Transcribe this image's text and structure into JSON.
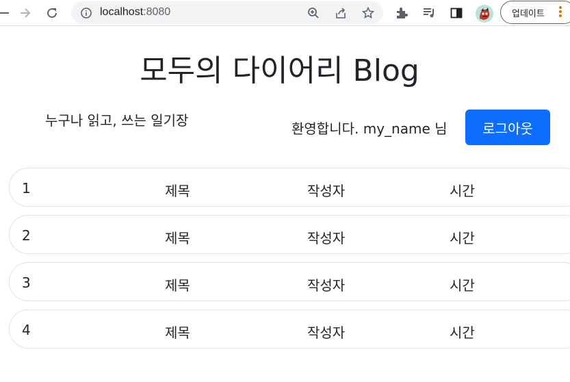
{
  "browser": {
    "url_host": "localhost",
    "url_port": ":8080",
    "update_label": "업데이트",
    "icons": [
      "back-icon",
      "forward-icon",
      "reload-icon",
      "info-icon",
      "zoom-icon",
      "share-icon",
      "star-icon",
      "extensions-icon",
      "media-icon",
      "sidebar-icon",
      "avatar",
      "menu-icon"
    ],
    "accent_color": "#e37400"
  },
  "page": {
    "title": "모두의 다이어리 Blog",
    "subtitle": "누구나 읽고, 쓰는 일기장",
    "welcome": "환영합니다. my_name 님",
    "logout_label": "로그아웃",
    "button_color": "#0d6efd"
  },
  "posts": [
    {
      "number": "1",
      "title": "제목",
      "author": "작성자",
      "time": "시간"
    },
    {
      "number": "2",
      "title": "제목",
      "author": "작성자",
      "time": "시간"
    },
    {
      "number": "3",
      "title": "제목",
      "author": "작성자",
      "time": "시간"
    },
    {
      "number": "4",
      "title": "제목",
      "author": "작성자",
      "time": "시간"
    }
  ]
}
